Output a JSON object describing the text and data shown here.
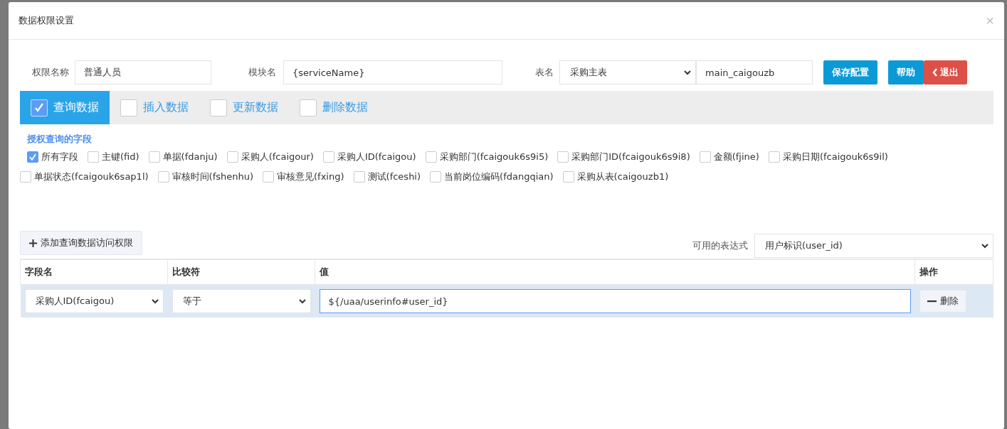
{
  "dialog": {
    "title": "数据权限设置",
    "close": "×"
  },
  "form": {
    "name_label": "权限名称",
    "name_value": "普通人员",
    "module_label": "模块名",
    "module_value": "{serviceName}",
    "table_label": "表名",
    "table_select": "采购主表",
    "table_code": "main_caigouzb"
  },
  "buttons": [
    {
      "label": "保存配置",
      "kind": "primary"
    },
    {
      "label": "帮助",
      "kind": "primary"
    },
    {
      "label": "退出",
      "kind": "danger"
    }
  ],
  "tabs": [
    {
      "label": "查询数据",
      "selected": true
    },
    {
      "label": "插入数据",
      "selected": false
    },
    {
      "label": "更新数据",
      "selected": false
    },
    {
      "label": "删除数据",
      "selected": false
    }
  ],
  "fields_title": "授权查询的字段",
  "fields": [
    {
      "label": "所有字段",
      "checked": true
    },
    {
      "label": "主键(fid)",
      "checked": false
    },
    {
      "label": "单据(fdanju)",
      "checked": false
    },
    {
      "label": "采购人(fcaigour)",
      "checked": false
    },
    {
      "label": "采购人ID(fcaigou)",
      "checked": false
    },
    {
      "label": "采购部门(fcaigouk6s9i5)",
      "checked": false
    },
    {
      "label": "采购部门ID(fcaigouk6s9i8)",
      "checked": false
    },
    {
      "label": "金额(fjine)",
      "checked": false
    },
    {
      "label": "采购日期(fcaigouk6s9il)",
      "checked": false
    },
    {
      "label": "单据状态(fcaigouk6sap1l)",
      "checked": false
    },
    {
      "label": "审核时间(fshenhu)",
      "checked": false
    },
    {
      "label": "审核意见(fxing)",
      "checked": false
    },
    {
      "label": "测试(fceshi)",
      "checked": false
    },
    {
      "label": "当前岗位编码(fdangqian)",
      "checked": false
    },
    {
      "label": "采购从表(caigouzb1)",
      "checked": false
    }
  ],
  "add_button": "添加查询数据访问权限",
  "expression": {
    "label": "可用的表达式",
    "value": "用户标识(user_id)"
  },
  "table": {
    "columns": [
      "字段名",
      "比较符",
      "值",
      "操作"
    ],
    "rows": [
      {
        "field": "采购人ID(fcaigou)",
        "operator": "等于",
        "value": "${/uaa/userinfo#user_id}",
        "action": "删除"
      }
    ]
  }
}
